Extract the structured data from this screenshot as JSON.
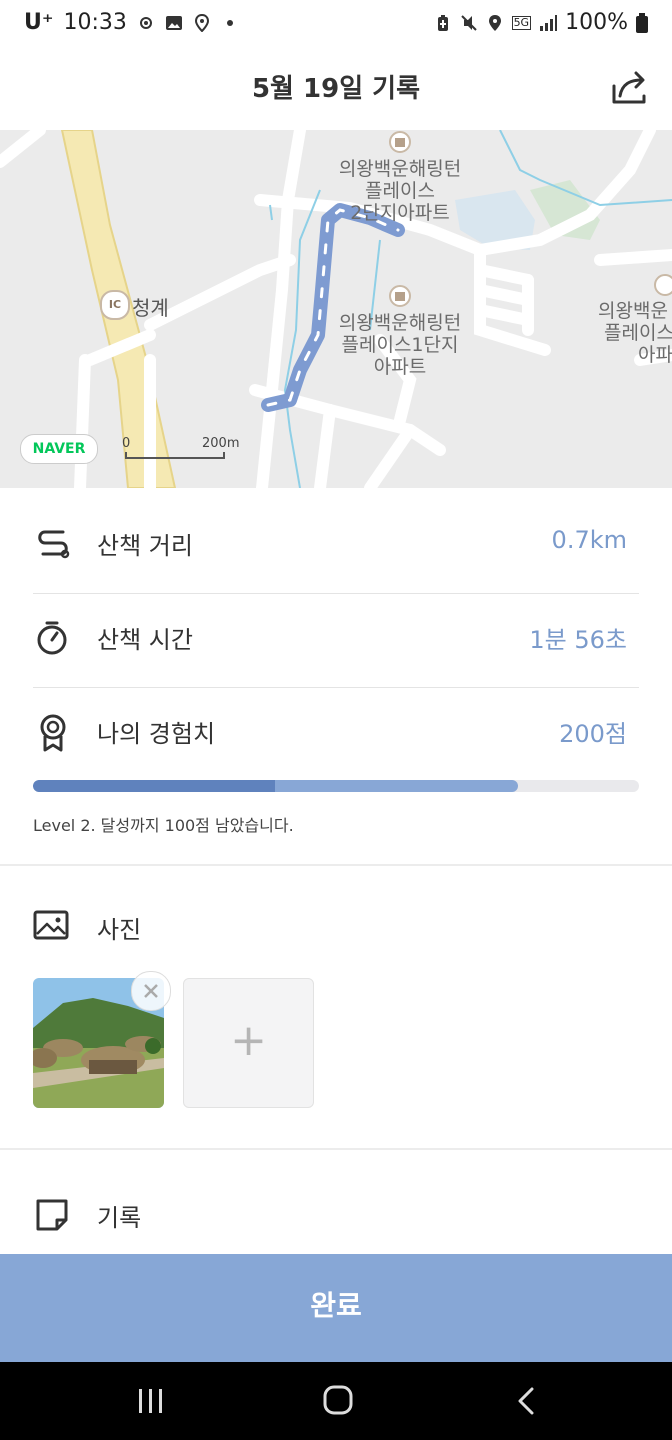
{
  "status_bar": {
    "carrier": "U⁺",
    "time": "10:33",
    "network": "5G",
    "battery": "100%"
  },
  "header": {
    "title": "5월 19일 기록"
  },
  "map": {
    "labels": {
      "place1": [
        "의왕백운해링턴",
        "플레이스",
        "2단지아파트"
      ],
      "place2": [
        "의왕백운해링턴",
        "플레이스1단지",
        "아파트"
      ],
      "place3": [
        "의왕백운",
        "플레이스",
        "아파"
      ],
      "ic_badge": "IC",
      "ic_name": "청계",
      "brand": "NAVER",
      "scale_zero": "0",
      "scale_distance": "200m"
    },
    "route_color": "#7e9bd1"
  },
  "stats": {
    "distance": {
      "label": "산책 거리",
      "value": "0.7km"
    },
    "time": {
      "label": "산책 시간",
      "value": "1분 56초"
    },
    "xp": {
      "label": "나의 경험치",
      "value": "200점"
    }
  },
  "progress": {
    "level_fraction": 0.4,
    "total_fraction": 0.8,
    "text": "Level 2. 달성까지 100점 남았습니다."
  },
  "photos": {
    "label": "사진",
    "add_symbol": "+"
  },
  "memo": {
    "label": "기록"
  },
  "done_button": {
    "label": "완료"
  },
  "colors": {
    "accent": "#87a7d6",
    "value_text": "#7a9acb",
    "progress_dark": "#5f82bd"
  }
}
